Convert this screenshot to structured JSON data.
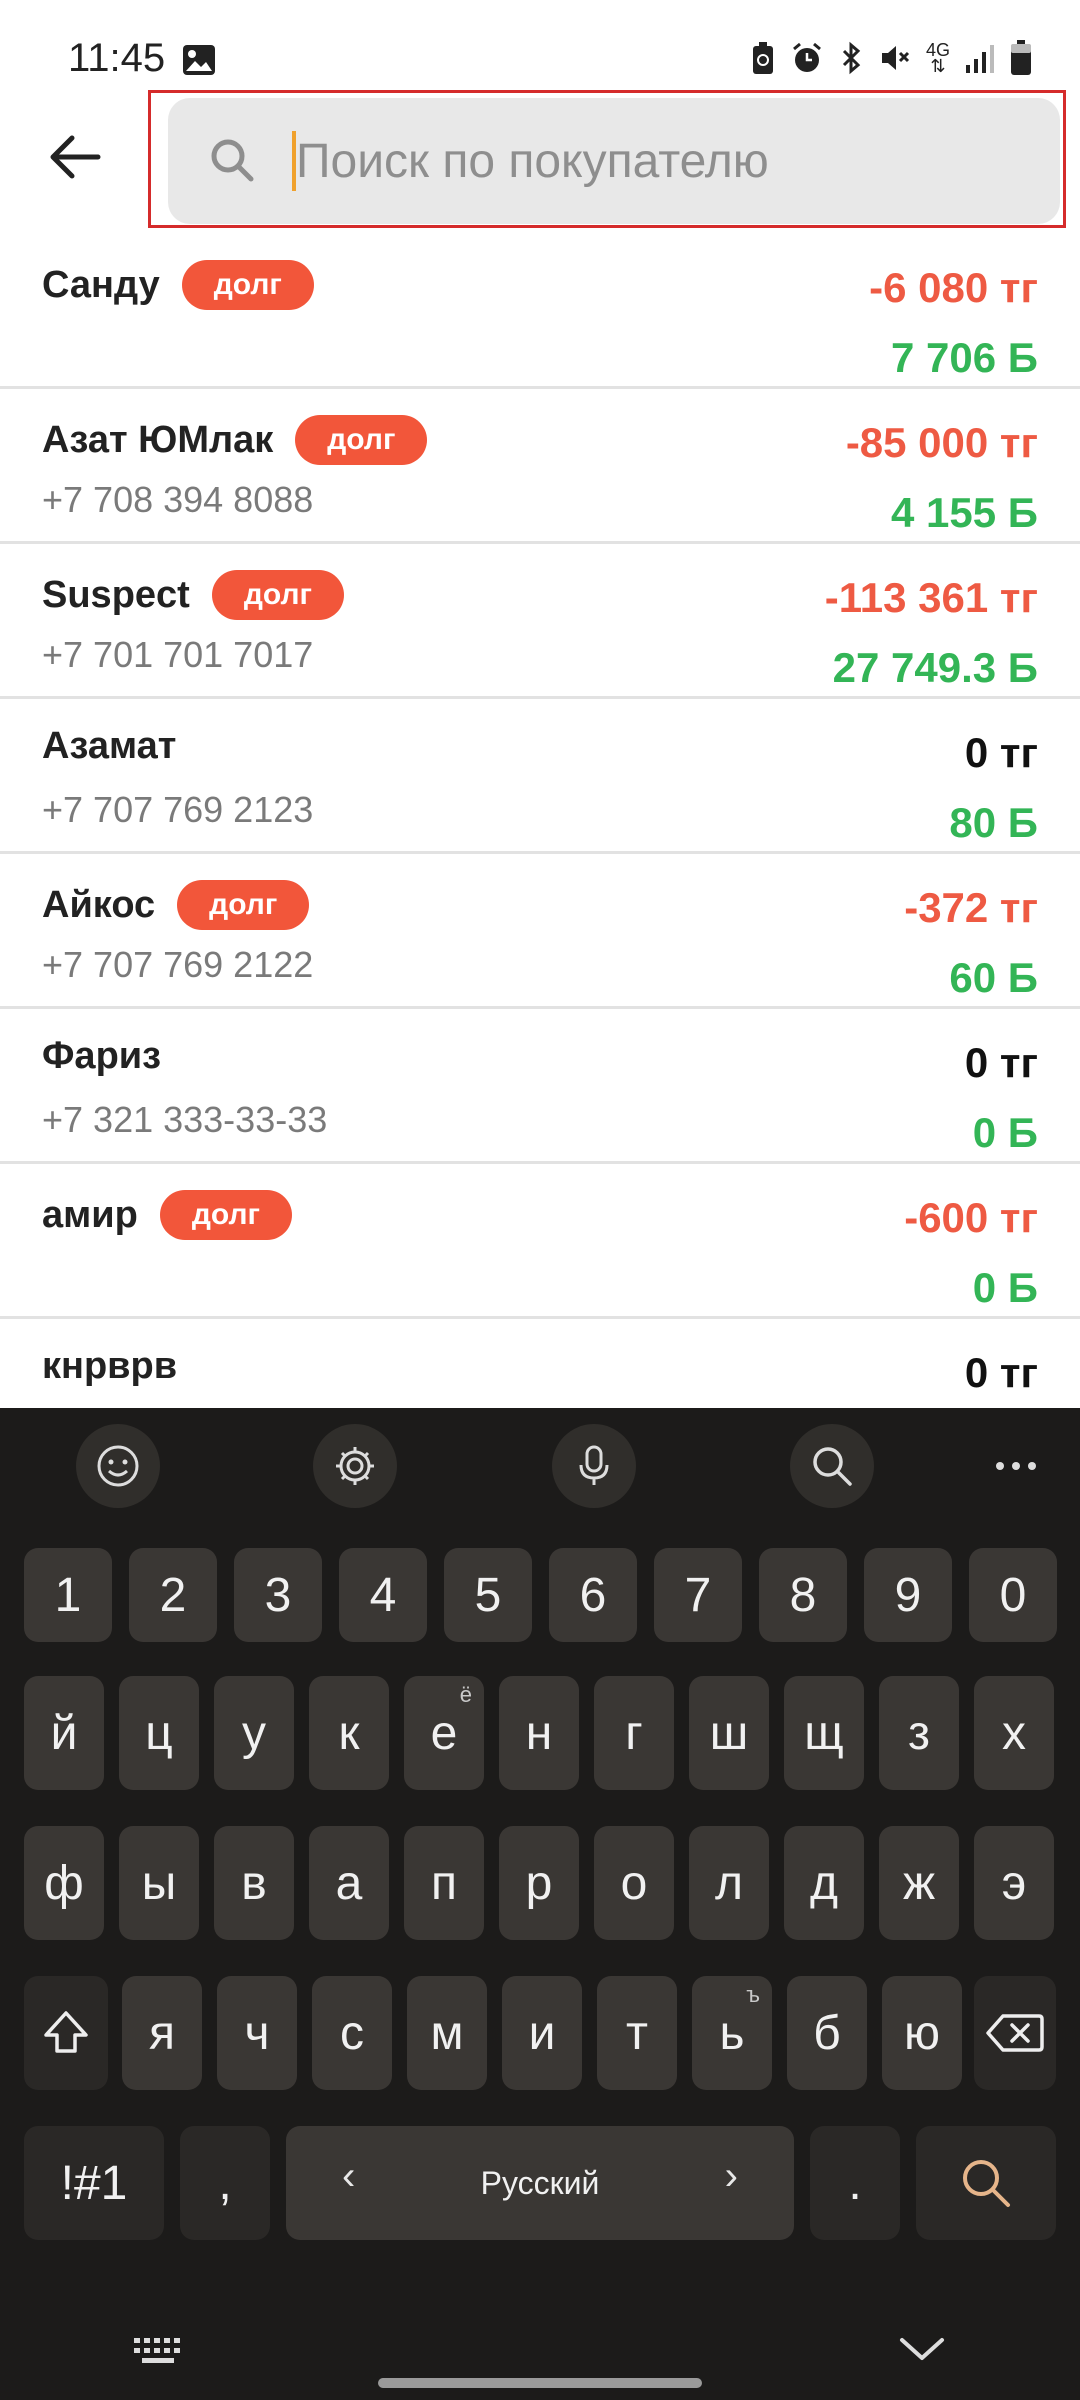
{
  "status_bar": {
    "time": "11:45",
    "icons": [
      "gallery-icon",
      "battery-saver-icon",
      "alarm-icon",
      "bluetooth-icon",
      "mute-icon",
      "4g-icon",
      "signal-icon",
      "battery-icon"
    ],
    "network_label": "4G"
  },
  "app_bar": {
    "search": {
      "placeholder": "Поиск по покупателю",
      "value": ""
    },
    "highlight_color": "#d52b2b"
  },
  "debt_badge_label": "долг",
  "customers": [
    {
      "name": "Санду",
      "phone": "",
      "debt": true,
      "balance": "-6 080 тг",
      "bonus": "7 706 Б"
    },
    {
      "name": "Азат ЮМлак",
      "phone": "+7 708 394 8088",
      "debt": true,
      "balance": "-85 000 тг",
      "bonus": "4 155 Б"
    },
    {
      "name": "Suspect",
      "phone": "+7 701 701 7017",
      "debt": true,
      "balance": "-113 361 тг",
      "bonus": "27 749.3 Б"
    },
    {
      "name": "Азамат",
      "phone": "+7 707 769 2123",
      "debt": false,
      "balance": "0 тг",
      "bonus": "80 Б"
    },
    {
      "name": "Айкос",
      "phone": "+7 707 769 2122",
      "debt": true,
      "balance": "-372 тг",
      "bonus": "60 Б"
    },
    {
      "name": "Фариз",
      "phone": "+7 321 333-33-33",
      "debt": false,
      "balance": "0 тг",
      "bonus": "0 Б"
    },
    {
      "name": "амир",
      "phone": "",
      "debt": true,
      "balance": "-600 тг",
      "bonus": "0 Б"
    },
    {
      "name": "кнрврв",
      "phone": "",
      "debt": false,
      "balance": "0 тг",
      "bonus": ""
    }
  ],
  "colors": {
    "negative_balance": "#ee5a43",
    "bonus": "#33b556",
    "debt_badge": "#f2563a",
    "keyboard_bg": "#1c1b1a",
    "key_bg": "#3a3734"
  },
  "keyboard": {
    "toolbar": [
      "emoji-icon",
      "settings-icon",
      "microphone-icon",
      "search-icon",
      "more-icon"
    ],
    "number_row": [
      "1",
      "2",
      "3",
      "4",
      "5",
      "6",
      "7",
      "8",
      "9",
      "0"
    ],
    "row1": [
      "й",
      "ц",
      "у",
      "к",
      "е",
      "н",
      "г",
      "ш",
      "щ",
      "з",
      "х"
    ],
    "row1_hint_e": "ё",
    "row2": [
      "ф",
      "ы",
      "в",
      "а",
      "п",
      "р",
      "о",
      "л",
      "д",
      "ж",
      "э"
    ],
    "row3": [
      "я",
      "ч",
      "с",
      "м",
      "и",
      "т",
      "ь",
      "б",
      "ю"
    ],
    "row3_hint_soft": "ъ",
    "symbols_key": "!#1",
    "comma_key": ",",
    "space_label": "Русский",
    "space_left": "‹",
    "space_right": "›",
    "period_key": "."
  }
}
